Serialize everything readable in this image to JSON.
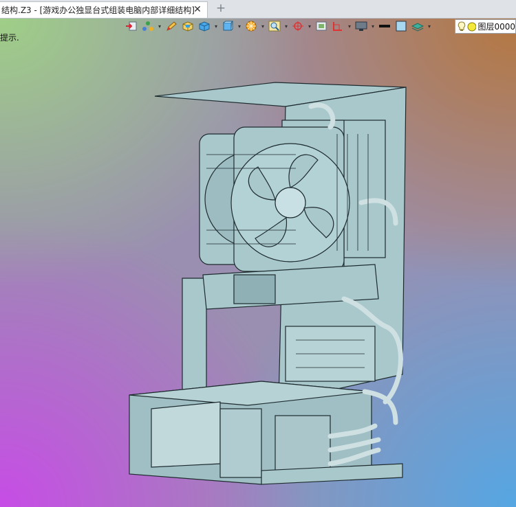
{
  "tab": {
    "title": "结构.Z3 - [游戏办公独显台式组装电脑内部详细结构]",
    "close": "✕",
    "add": "+"
  },
  "hint": "提示.",
  "toolbar": {
    "items": [
      "import-icon",
      "view-tree-icon",
      "pen-icon",
      "box-icon",
      "cube-icon",
      "cube-shaded-icon",
      "render-wheel-icon",
      "zoom-fit-icon",
      "axis-icon",
      "frame-icon",
      "section-icon",
      "monitor-icon",
      "line-weight-icon",
      "color-swatch-icon",
      "layer-stack-icon"
    ]
  },
  "layer": {
    "label": "图层0000"
  },
  "colors": {
    "model_fill": "#a9c8cc",
    "model_stroke": "#1d2a2e",
    "hose": "#cfe0e2"
  }
}
